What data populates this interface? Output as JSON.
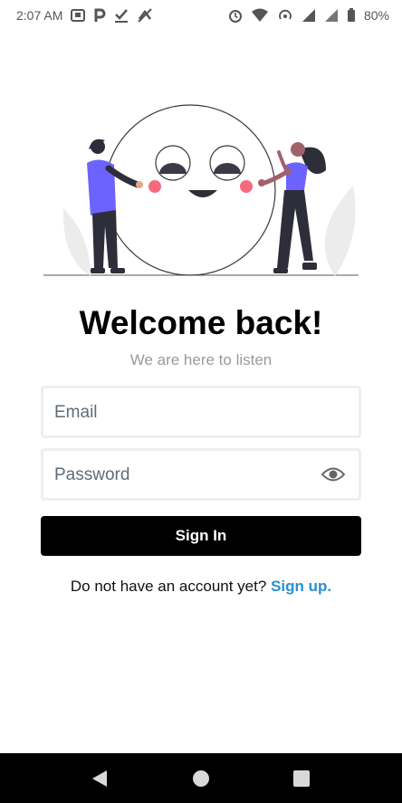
{
  "status_bar": {
    "time": "2:07 AM",
    "battery": "80%",
    "left_icons": [
      "screenshot-icon",
      "p-icon",
      "checkmark-icon",
      "muted-icon"
    ],
    "right_icons": [
      "alarm-icon",
      "wifi-icon",
      "hotspot-icon",
      "signal-icon",
      "signal-icon",
      "battery-icon"
    ]
  },
  "illustration": {
    "description_icons": [
      "person-left",
      "smiley-face-circle",
      "person-right",
      "leaf"
    ],
    "accent_color": "#6c63ff"
  },
  "login": {
    "title": "Welcome back!",
    "subtitle": "We are here to listen",
    "email_placeholder": "Email",
    "password_placeholder": "Password",
    "signin_label": "Sign In",
    "signup_prompt": "Do not have an account yet?",
    "signup_link": "Sign up."
  },
  "colors": {
    "link": "#2a8fd0",
    "button_bg": "#000000",
    "button_text": "#ffffff",
    "subtitle": "#9a9a9a"
  }
}
